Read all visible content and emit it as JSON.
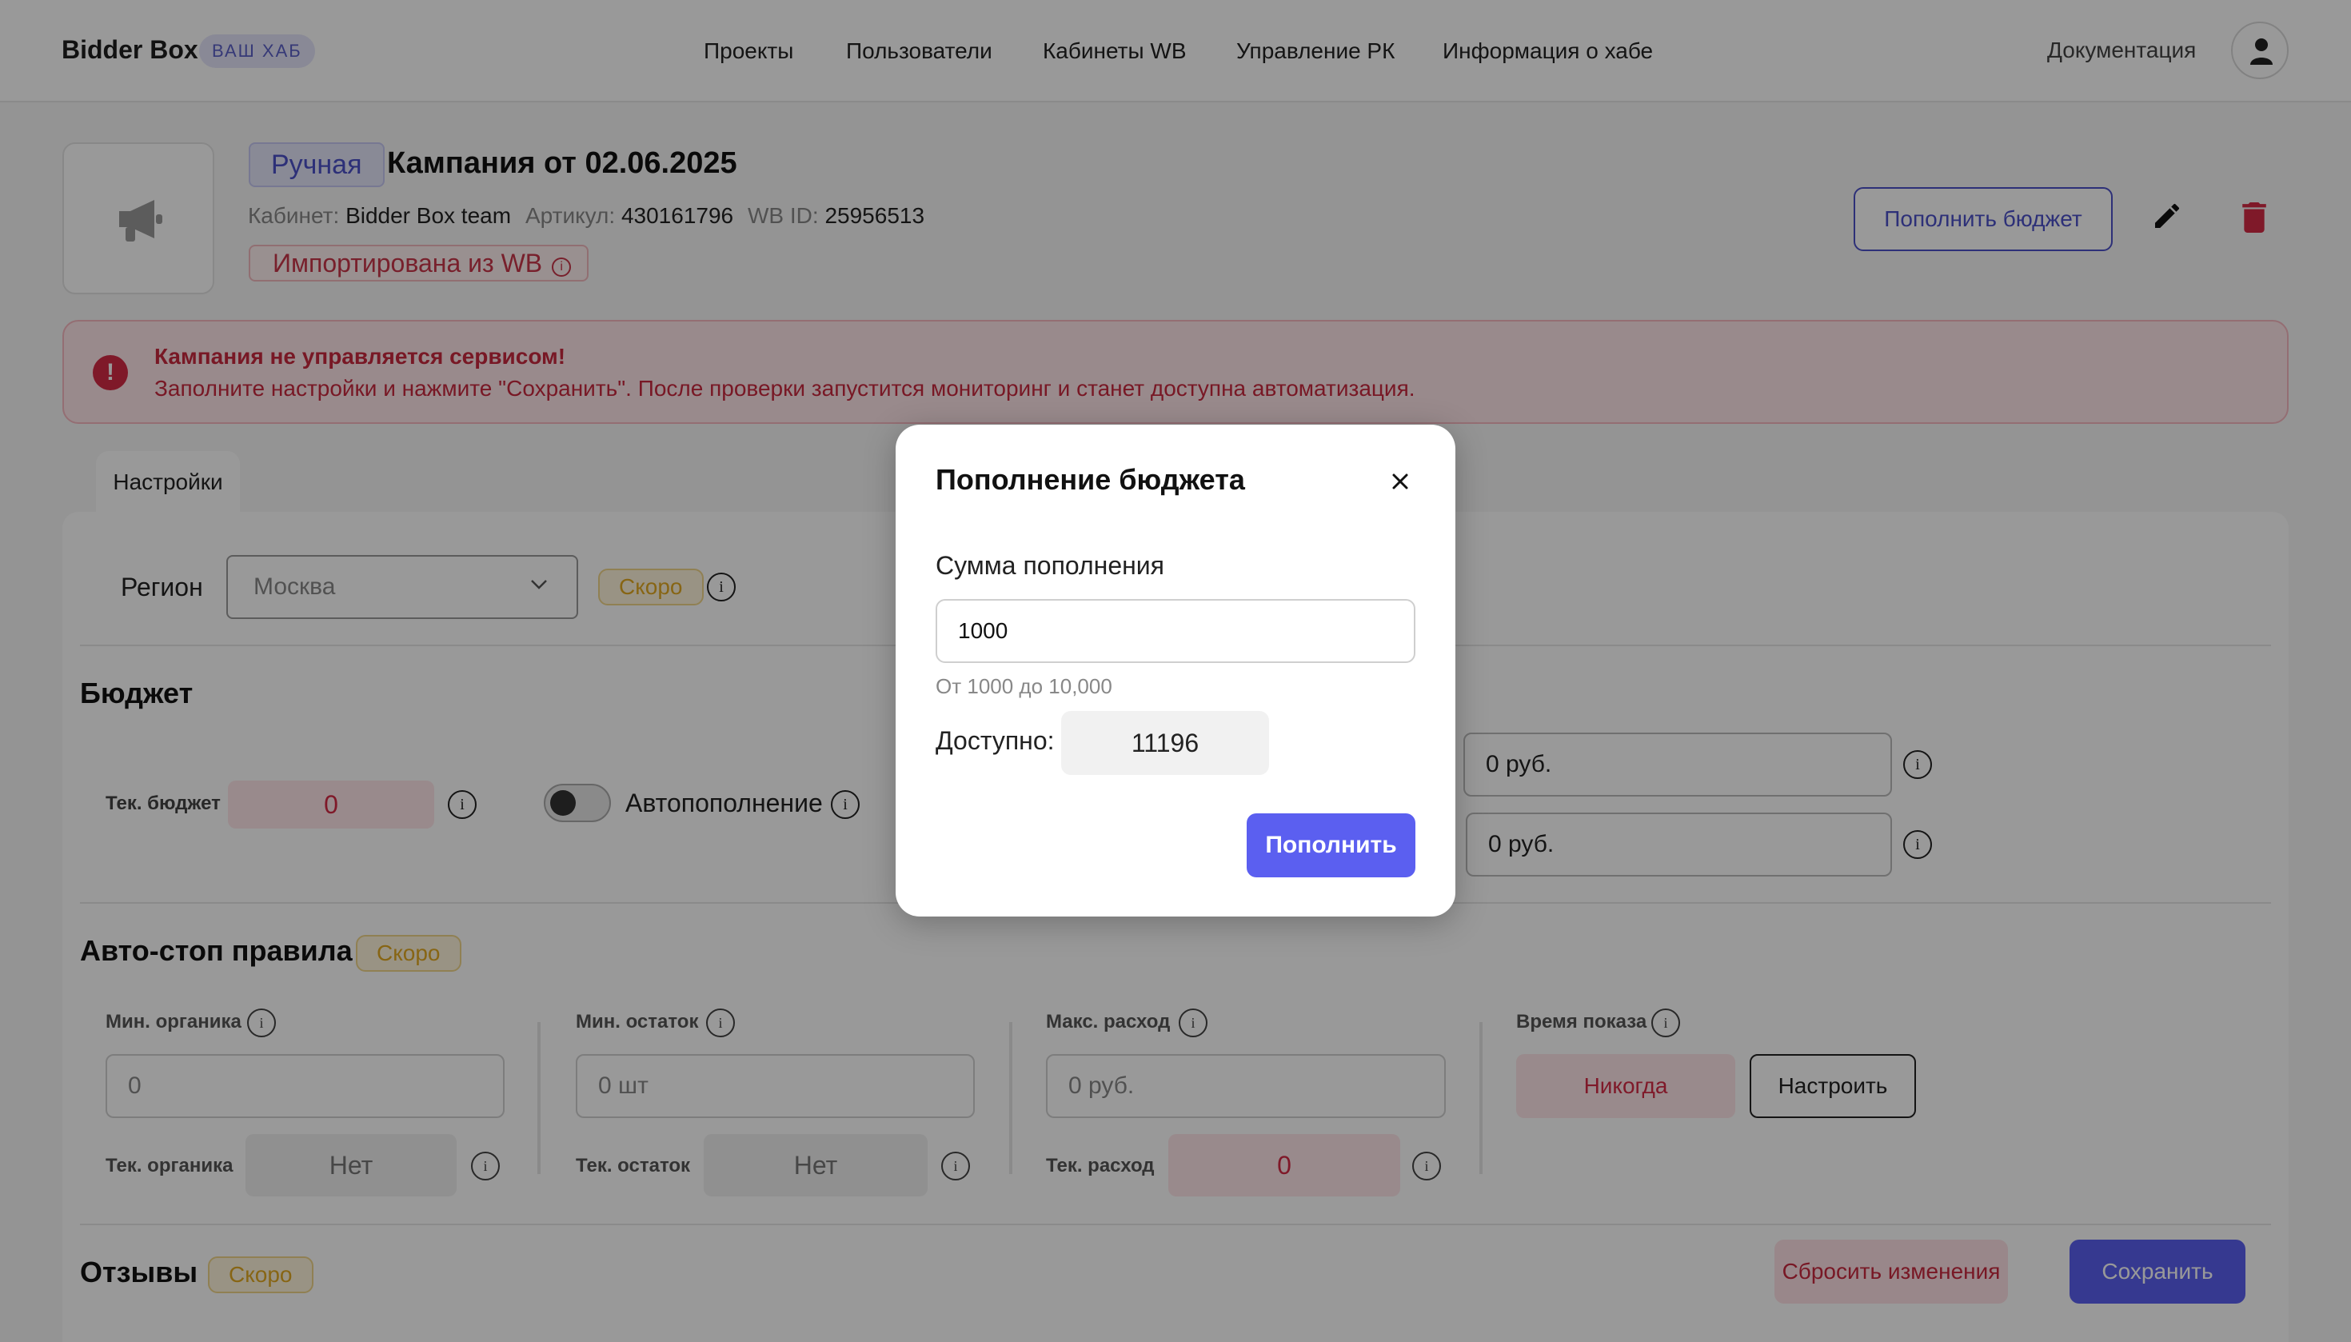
{
  "header": {
    "logo": "Bidder Box",
    "hub_badge": "ВАШ ХАБ",
    "nav": [
      "Проекты",
      "Пользователи",
      "Кабинеты WB",
      "Управление РК",
      "Информация о хабе"
    ],
    "docs": "Документация"
  },
  "campaign": {
    "type_badge": "Ручная",
    "title": "Кампания от 02.06.2025",
    "cabinet_label": "Кабинет:",
    "cabinet_value": "Bidder Box team",
    "article_label": "Артикул:",
    "article_value": "430161796",
    "wbid_label": "WB ID:",
    "wbid_value": "25956513",
    "import_badge": "Импортирована из WB",
    "topup_button": "Пополнить бюджет"
  },
  "alert": {
    "icon": "!",
    "title": "Кампания не управляется сервисом!",
    "text": "Заполните настройки и нажмите \"Сохранить\". После проверки запустится мониторинг и станет доступна автоматизация."
  },
  "settings": {
    "tab": "Настройки",
    "region_label": "Регион",
    "region_value": "Москва",
    "soon": "Скоро",
    "budget_title": "Бюджет",
    "current_budget_label": "Тек. бюджет",
    "current_budget_value": "0",
    "autofill_label": "Автопополнение",
    "right_input_1": "0 руб.",
    "right_input_2": "0 руб.",
    "autostop_title": "Авто-стоп правила",
    "min_organic_label": "Мин. органика",
    "min_organic_value": "0",
    "cur_organic_label": "Тек. органика",
    "cur_organic_value": "Нет",
    "min_stock_label": "Мин. остаток",
    "min_stock_value": "0 шт",
    "cur_stock_label": "Тек. остаток",
    "cur_stock_value": "Нет",
    "max_spend_label": "Макс. расход",
    "max_spend_value": "0 руб.",
    "cur_spend_label": "Тек. расход",
    "cur_spend_value": "0",
    "show_time_label": "Время показа",
    "show_time_value": "Никогда",
    "configure_button": "Настроить",
    "reviews_title": "Отзывы",
    "reset_button": "Сбросить изменения",
    "save_button": "Сохранить"
  },
  "modal": {
    "title": "Пополнение бюджета",
    "amount_label": "Сумма пополнения",
    "amount_value": "1000",
    "hint": "От 1000 до 10,000",
    "available_label": "Доступно:",
    "available_value": "11196",
    "submit": "Пополнить"
  },
  "colors": {
    "accent": "#5b5ff0",
    "danger": "#d42a45",
    "warning": "#e2a922"
  }
}
